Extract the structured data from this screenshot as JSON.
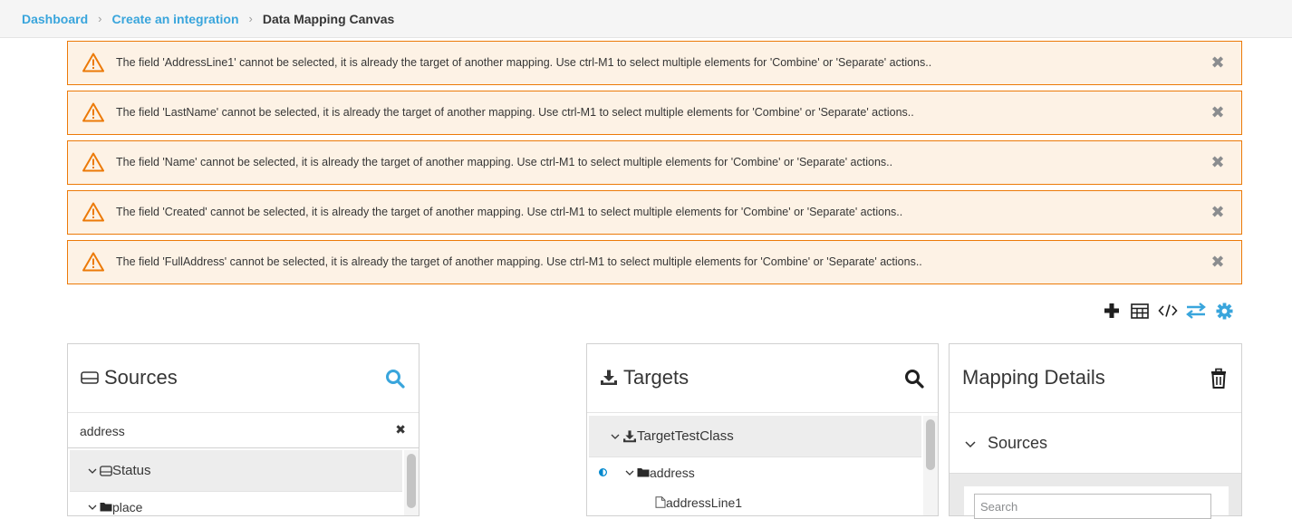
{
  "breadcrumb": {
    "items": [
      "Dashboard",
      "Create an integration"
    ],
    "current": "Data Mapping Canvas"
  },
  "alerts": [
    {
      "message": "The field 'AddressLine1' cannot be selected, it is already the target of another mapping. Use ctrl-M1 to select multiple elements for 'Combine' or 'Separate' actions.."
    },
    {
      "message": "The field 'LastName' cannot be selected, it is already the target of another mapping. Use ctrl-M1 to select multiple elements for 'Combine' or 'Separate' actions.."
    },
    {
      "message": "The field 'Name' cannot be selected, it is already the target of another mapping. Use ctrl-M1 to select multiple elements for 'Combine' or 'Separate' actions.."
    },
    {
      "message": "The field 'Created' cannot be selected, it is already the target of another mapping. Use ctrl-M1 to select multiple elements for 'Combine' or 'Separate' actions.."
    },
    {
      "message": "The field 'FullAddress' cannot be selected, it is already the target of another mapping. Use ctrl-M1 to select multiple elements for 'Combine' or 'Separate' actions.."
    }
  ],
  "toolbar": {
    "icons": [
      "plus-icon",
      "table-icon",
      "code-icon",
      "exchange-icon",
      "gear-icon"
    ],
    "active_color": "#39a5dc"
  },
  "sources": {
    "title": "Sources",
    "filter_value": "address",
    "tree": {
      "doc": "Status",
      "nodes": [
        "place"
      ]
    }
  },
  "targets": {
    "title": "Targets",
    "tree": {
      "doc": "TargetTestClass",
      "folder": "address",
      "field": "addressLine1"
    }
  },
  "details": {
    "title": "Mapping Details",
    "section": "Sources",
    "search_placeholder": "Search"
  },
  "colors": {
    "link": "#39a5dc",
    "warning_border": "#ec7a08",
    "warning_bg": "#fdf2e5"
  }
}
